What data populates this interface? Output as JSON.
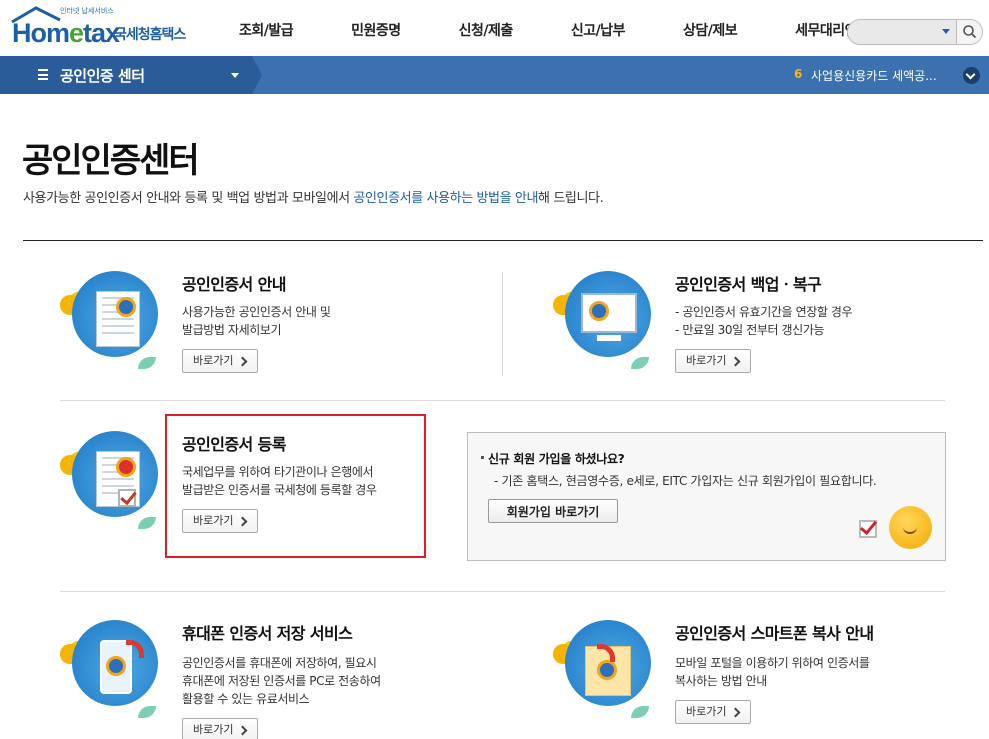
{
  "header": {
    "logo_tagline": "인터넷 납세서비스",
    "logo_brand_a": "Hom",
    "logo_brand_e": "e",
    "logo_brand_b": "tax",
    "logo_brand_kr": "국세청홈택스",
    "menu": [
      "조회/발급",
      "민원증명",
      "신청/제출",
      "신고/납부",
      "상담/제보",
      "세무대리인"
    ],
    "search": {
      "placeholder": ""
    }
  },
  "navbar": {
    "section_title": "공인인증 센터",
    "notice_number": "6",
    "notice_text": "사업용신용카드 세액공..."
  },
  "page": {
    "title": "공인인증센터",
    "desc_before": "사용가능한 공인인증서 안내와 등록 및 백업 방법과 모바일에서 ",
    "desc_highlight": "공인인증서를 사용하는 방법을 안내",
    "desc_after": "해 드립니다."
  },
  "cards": {
    "guide": {
      "title": "공인인증서 안내",
      "lines": [
        "사용가능한 공인인증서 안내 및",
        "발급방법 자세히보기"
      ],
      "button": "바로가기"
    },
    "backup": {
      "title": "공인인증서 백업ㆍ복구",
      "lines": [
        "- 공인인증서 유효기간을 연장할 경우",
        "- 만료일 30일 전부터 갱신가능"
      ],
      "button": "바로가기"
    },
    "register": {
      "title": "공인인증서 등록",
      "lines": [
        "국세업무를 위하여 타기관이나 은행에서",
        "발급받은 인증서를 국세청에 등록할 경우"
      ],
      "button": "바로가기"
    },
    "phone": {
      "title": "휴대폰 인증서 저장 서비스",
      "lines": [
        "공인인증서를 휴대폰에 저장하여, 필요시",
        "휴대폰에 저장된 인증서를 PC로 전송하여",
        "활용할 수 있는 유료서비스"
      ],
      "button": "바로가기"
    },
    "smartphone": {
      "title": "공인인증서 스마트폰 복사 안내",
      "lines": [
        "모바일 포털을 이용하기 위하여 인증서를",
        "복사하는 방법 안내"
      ],
      "button": "바로가기"
    }
  },
  "signup": {
    "question": "신규 회원 가입을 하셨나요?",
    "note": "- 기존 홈택스, 현금영수증, e세로, EITC 가입자는 신규 회원가입이 필요합니다.",
    "button": "회원가입 바로가기"
  }
}
